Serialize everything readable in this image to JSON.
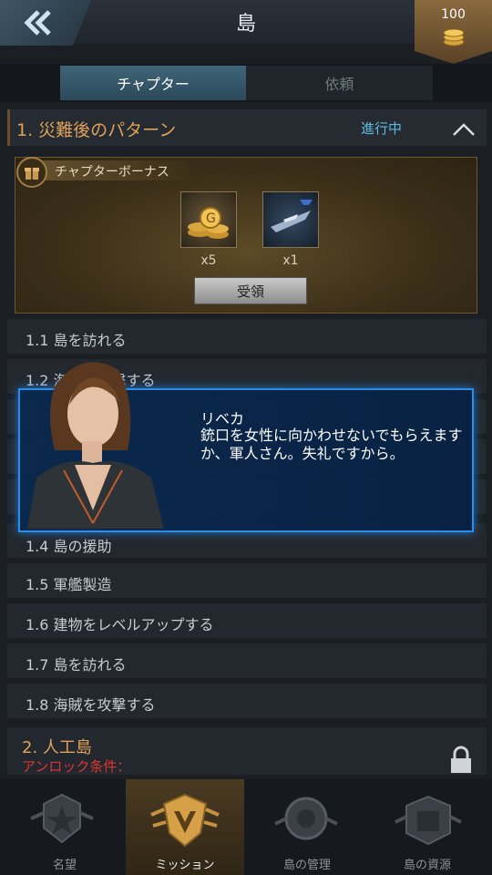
{
  "header": {
    "title": "島",
    "coins": "100"
  },
  "tabs": [
    {
      "label": "チャプター"
    },
    {
      "label": "依頼"
    }
  ],
  "chapter1": {
    "title": "1. 災難後のパターン",
    "status": "進行中",
    "bonus": {
      "label": "チャプターボーナス",
      "rewards": [
        {
          "name": "gold-coins",
          "qty": "x5"
        },
        {
          "name": "warship",
          "qty": "x1"
        }
      ],
      "claim_label": "受領"
    },
    "items": [
      "1.1 島を訪れる",
      "1.2 海賊を攻撃する",
      "1.4 島の援助",
      "1.5 軍艦製造",
      "1.6 建物をレベルアップする",
      "1.7 島を訪れる",
      "1.8 海賊を攻撃する"
    ]
  },
  "chapter2": {
    "title": "2. 人工島",
    "unlock": "アンロック条件："
  },
  "dialog": {
    "speaker": "リベカ",
    "text": "銃口を女性に向かわせないでもらえますか、軍人さん。失礼ですから。"
  },
  "nav": [
    {
      "label": "名望"
    },
    {
      "label": "ミッション"
    },
    {
      "label": "島の管理"
    },
    {
      "label": "島の資源"
    }
  ],
  "colors": {
    "accent": "#2c8de6",
    "chapter_title": "#e0a15a",
    "status": "#5fb8e0",
    "locked": "#e03434"
  }
}
